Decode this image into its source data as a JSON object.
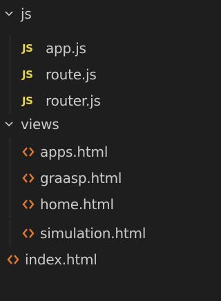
{
  "explorer": {
    "folders": [
      {
        "label": "js",
        "icon": "chevron-down-icon",
        "expanded": true
      },
      {
        "label": "views",
        "icon": "chevron-down-icon",
        "expanded": true
      }
    ],
    "js_files": [
      {
        "label": "app.js",
        "icon": "js-file-icon",
        "icon_text": "JS"
      },
      {
        "label": "route.js",
        "icon": "js-file-icon",
        "icon_text": "JS"
      },
      {
        "label": "router.js",
        "icon": "js-file-icon",
        "icon_text": "JS"
      }
    ],
    "view_files": [
      {
        "label": "apps.html",
        "icon": "html-file-icon"
      },
      {
        "label": "graasp.html",
        "icon": "html-file-icon"
      },
      {
        "label": "home.html",
        "icon": "html-file-icon"
      },
      {
        "label": "simulation.html",
        "icon": "html-file-icon"
      }
    ],
    "root_files": [
      {
        "label": "index.html",
        "icon": "html-file-icon"
      }
    ]
  },
  "colors": {
    "background": "#1e1e1e",
    "text": "#cccccc",
    "js_icon": "#e8d44d",
    "html_icon": "#e37933",
    "indent_guide": "#3c3c3c"
  }
}
